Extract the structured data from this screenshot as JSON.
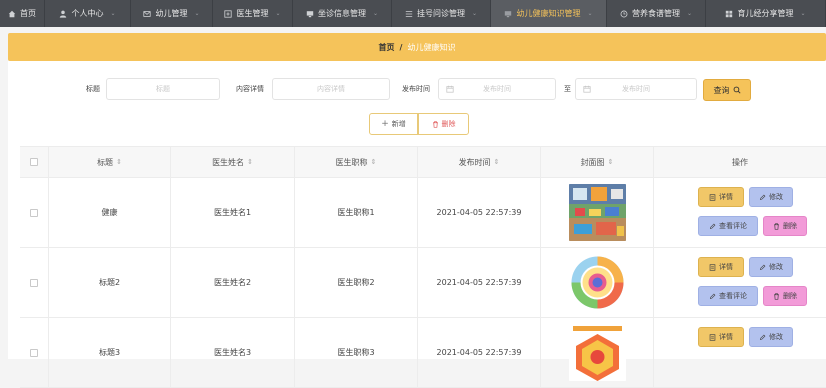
{
  "nav": {
    "items": [
      {
        "label": "首页",
        "icon": "home-icon",
        "active": false
      },
      {
        "label": "个人中心",
        "icon": "user-icon",
        "active": false
      },
      {
        "label": "幼儿管理",
        "icon": "mail-icon",
        "active": false
      },
      {
        "label": "医生管理",
        "icon": "doctor-icon",
        "active": false
      },
      {
        "label": "坐诊信息管理",
        "icon": "monitor-icon",
        "active": false
      },
      {
        "label": "挂号问诊管理",
        "icon": "list-icon",
        "active": false
      },
      {
        "label": "幼儿健康知识管理",
        "icon": "monitor-icon",
        "active": true
      },
      {
        "label": "营养食谱管理",
        "icon": "clock-icon",
        "active": false
      },
      {
        "label": "育儿经分享管理",
        "icon": "grid-icon",
        "active": false
      }
    ]
  },
  "breadcrumb": {
    "home": "首页",
    "separator": "/",
    "current": "幼儿健康知识"
  },
  "search": {
    "title_label": "标题",
    "title_placeholder": "标题",
    "content_label": "内容详情",
    "content_placeholder": "内容详情",
    "date_label": "发布时间",
    "date_from_placeholder": "发布时间",
    "range_sep": "至",
    "date_to_placeholder": "发布时间",
    "search_button": "查询"
  },
  "actions": {
    "add_label": "新增",
    "delete_label": "删除"
  },
  "table": {
    "columns": [
      "标题",
      "医生姓名",
      "医生职称",
      "发布时间",
      "封面图",
      "操作"
    ],
    "rows": [
      {
        "title": "健康",
        "doctor_name": "医生姓名1",
        "doctor_title": "医生职称1",
        "publish_time": "2021-04-05 22:57:39",
        "cover": "classroom"
      },
      {
        "title": "标题2",
        "doctor_name": "医生姓名2",
        "doctor_title": "医生职称2",
        "publish_time": "2021-04-05 22:57:39",
        "cover": "nutrition-wheel"
      },
      {
        "title": "标题3",
        "doctor_name": "医生姓名3",
        "doctor_title": "医生职称3",
        "publish_time": "2021-04-05 22:57:39",
        "cover": "infographic"
      }
    ],
    "row_actions": {
      "detail": "详情",
      "edit": "修改",
      "comment": "查看评论",
      "delete": "删除"
    }
  },
  "colors": {
    "nav_bg": "#4a4d52",
    "accent": "#f5c35a",
    "edit_button": "#b3c2ee",
    "delete_button": "#f29bd8",
    "danger_text": "#e05a5a"
  }
}
